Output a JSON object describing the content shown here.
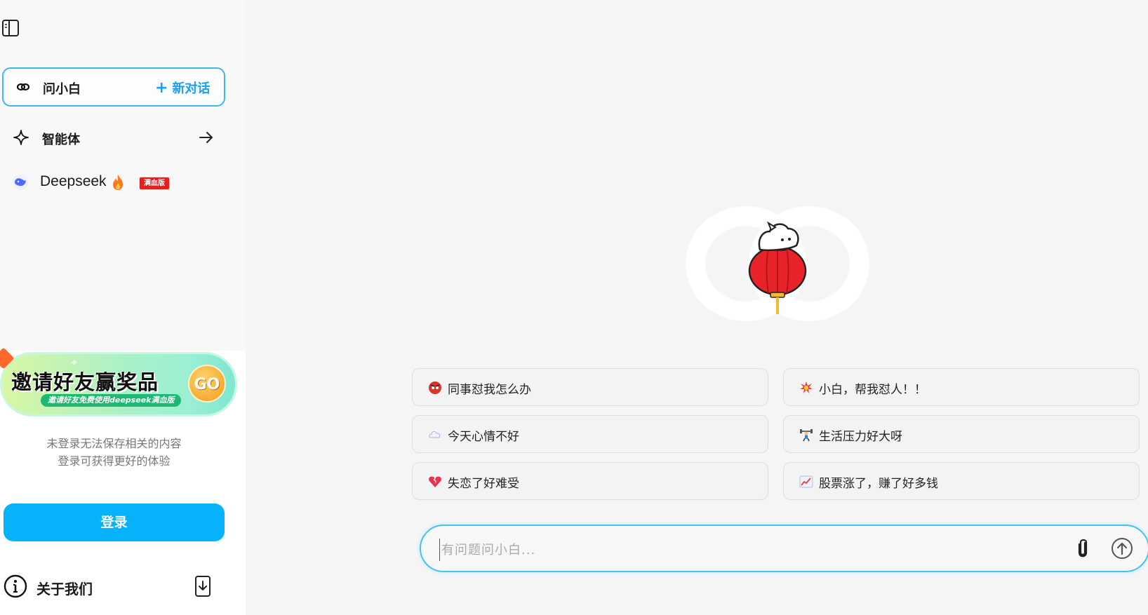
{
  "sidebar": {
    "ask": {
      "label": "问小白",
      "new_chat_plus": "+",
      "new_chat": "新对话"
    },
    "agent": {
      "label": "智能体"
    },
    "deepseek": {
      "label": "Deepseek",
      "badge": "满血版"
    },
    "banner": {
      "title": "邀请好友赢奖品",
      "subtitle": "邀请好友免费使用deepseek满血版",
      "go": "GO"
    },
    "notice_line1": "未登录无法保存相关的内容",
    "notice_line2": "登录可获得更好的体验",
    "login": "登录",
    "about": "关于我们"
  },
  "suggestions": [
    {
      "text": "同事怼我怎么办",
      "icon": "angry-face-emoji"
    },
    {
      "text": "小白，帮我怼人！！",
      "icon": "explosion-emoji"
    },
    {
      "text": "今天心情不好",
      "icon": "cloud-emoji"
    },
    {
      "text": "生活压力好大呀",
      "icon": "weightlifter-emoji"
    },
    {
      "text": "失恋了好难受",
      "icon": "broken-heart-emoji"
    },
    {
      "text": "股票涨了，赚了好多钱",
      "icon": "chart-up-emoji"
    }
  ],
  "input": {
    "placeholder": "有问题问小白..."
  },
  "colors": {
    "accent": "#06b3fb",
    "border_accent": "#43c3f0",
    "badge_red": "#e61e1e",
    "new_chat_blue": "#1aa0ec"
  }
}
